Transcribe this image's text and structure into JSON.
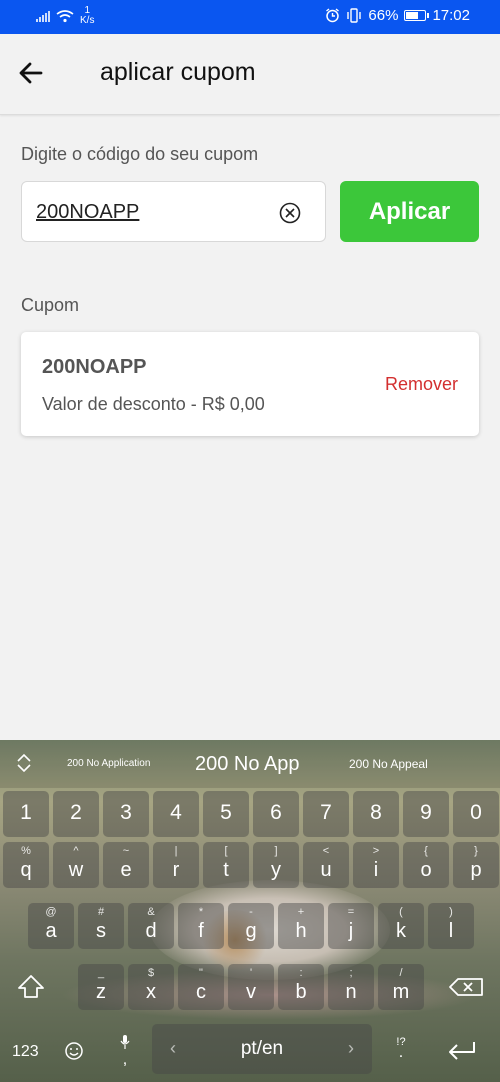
{
  "status_bar": {
    "net_speed_value": "1",
    "net_speed_unit": "K/s",
    "battery": "66%",
    "time": "17:02",
    "battery_level": 0.66
  },
  "app_bar": {
    "title": "aplicar cupom"
  },
  "coupon_input": {
    "label": "Digite o código do seu cupom",
    "value": "200NOAPP",
    "apply_label": "Aplicar"
  },
  "coupon_section": {
    "label": "Cupom",
    "code": "200NOAPP",
    "discount": "Valor de desconto - R$ 0,00",
    "remove_label": "Remover"
  },
  "keyboard": {
    "suggestions": [
      "200 No Application",
      "200 No App",
      "200 No Appeal"
    ],
    "number_row": [
      "1",
      "2",
      "3",
      "4",
      "5",
      "6",
      "7",
      "8",
      "9",
      "0"
    ],
    "row1": [
      {
        "main": "q",
        "sub": "%"
      },
      {
        "main": "w",
        "sub": "^"
      },
      {
        "main": "e",
        "sub": "~"
      },
      {
        "main": "r",
        "sub": "|"
      },
      {
        "main": "t",
        "sub": "["
      },
      {
        "main": "y",
        "sub": "]"
      },
      {
        "main": "u",
        "sub": "<"
      },
      {
        "main": "i",
        "sub": ">"
      },
      {
        "main": "o",
        "sub": "{"
      },
      {
        "main": "p",
        "sub": "}"
      }
    ],
    "row2": [
      {
        "main": "a",
        "sub": "@"
      },
      {
        "main": "s",
        "sub": "#"
      },
      {
        "main": "d",
        "sub": "&"
      },
      {
        "main": "f",
        "sub": "*"
      },
      {
        "main": "g",
        "sub": "-"
      },
      {
        "main": "h",
        "sub": "+"
      },
      {
        "main": "j",
        "sub": "="
      },
      {
        "main": "k",
        "sub": "("
      },
      {
        "main": "l",
        "sub": ")"
      }
    ],
    "row3": [
      {
        "main": "z",
        "sub": "_"
      },
      {
        "main": "x",
        "sub": "$"
      },
      {
        "main": "c",
        "sub": "\""
      },
      {
        "main": "v",
        "sub": "'"
      },
      {
        "main": "b",
        "sub": ":"
      },
      {
        "main": "n",
        "sub": ";"
      },
      {
        "main": "m",
        "sub": "/"
      }
    ],
    "mode_key": "123",
    "space_label": "pt/en",
    "punct_key": ",",
    "punct_alt": "!?"
  }
}
